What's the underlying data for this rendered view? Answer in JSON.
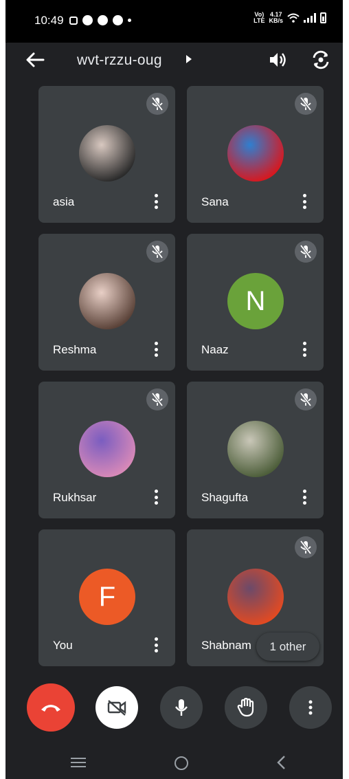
{
  "status_bar": {
    "time": "10:49",
    "network_label_top": "Vo)",
    "network_label_bottom": "LTE",
    "speed_top": "4.17",
    "speed_bottom": "KB/s"
  },
  "header": {
    "meeting_code": "wvt-rzzu-oug"
  },
  "participants": [
    {
      "name": "asia",
      "avatar_type": "photo",
      "avatar_colors": [
        "#2b2b2b",
        "#d8c8c0"
      ],
      "muted": true
    },
    {
      "name": "Sana",
      "avatar_type": "photo",
      "avatar_colors": [
        "#d7181f",
        "#2f7fd0"
      ],
      "muted": true
    },
    {
      "name": "Reshma",
      "avatar_type": "photo",
      "avatar_colors": [
        "#5a4238",
        "#e8cfc6"
      ],
      "muted": true
    },
    {
      "name": "Naaz",
      "avatar_type": "initial",
      "initial": "N",
      "avatar_colors": [
        "#6aa23a"
      ],
      "muted": true
    },
    {
      "name": "Rukhsar",
      "avatar_type": "photo",
      "avatar_colors": [
        "#d889b8",
        "#7a5dc0"
      ],
      "muted": true
    },
    {
      "name": "Shagufta",
      "avatar_type": "photo",
      "avatar_colors": [
        "#4d5e3a",
        "#c9c7b8"
      ],
      "muted": true
    },
    {
      "name": "You",
      "avatar_type": "initial",
      "initial": "F",
      "avatar_colors": [
        "#ec5a26"
      ],
      "muted": false
    },
    {
      "name": "Shabnam",
      "avatar_type": "photo",
      "avatar_colors": [
        "#e24a22",
        "#6b4a6a"
      ],
      "muted": true
    }
  ],
  "overflow_label": "1 other",
  "colors": {
    "background": "#202124",
    "tile": "#3c4043",
    "hangup": "#ea4335"
  }
}
